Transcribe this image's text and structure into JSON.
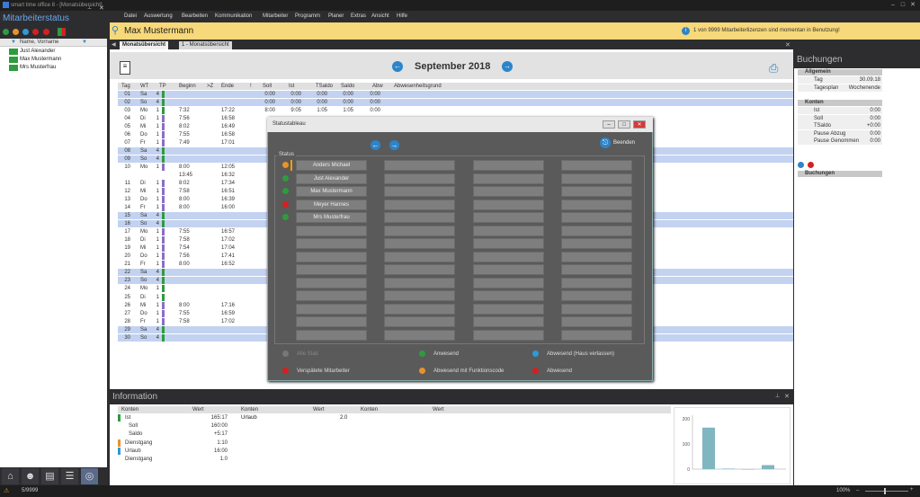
{
  "app": {
    "title": "smart time office 8 - [Monatsübersicht]"
  },
  "left": {
    "title": "Mitarbeiterstatus",
    "col": "Name, Vorname",
    "rows": [
      "Just Alexander",
      "Max Mustermann",
      "Mrs Musterfrau"
    ]
  },
  "menu": [
    "Datei",
    "Auswertung",
    "Bearbeiten",
    "Kommunikation",
    "Mitarbeiter",
    "Programm",
    "Planer",
    "Extras",
    "Ansicht",
    "Hilfe"
  ],
  "user": {
    "name": "Max Mustermann"
  },
  "license": {
    "text": "1 von 9999 Mitarbeiterlizenzen sind momentan in Benutzung!",
    "icon": "i"
  },
  "tabs": [
    "Monatsübersicht",
    "1 - Monatsübersicht"
  ],
  "month": {
    "title": "September 2018"
  },
  "columns": [
    "Tag",
    "WT",
    "TP",
    "Beginn",
    ">Z",
    "Ende",
    "!",
    "Soll",
    "Ist",
    "TSaldo",
    "Saldo",
    "Abw",
    "Abwesenheitsgrund"
  ],
  "rows": [
    {
      "tag": "01",
      "wt": "Sa",
      "tp": "4",
      "blue": true,
      "bar": "#2e9b3f",
      "b": "",
      "e": "",
      "soll": "0:00",
      "ist": "0:00",
      "ts": "0:00",
      "sal": "0:00",
      "abw": "0:00"
    },
    {
      "tag": "02",
      "wt": "So",
      "tp": "4",
      "blue": true,
      "bar": "#2e9b3f",
      "b": "",
      "e": "",
      "soll": "0:00",
      "ist": "0:00",
      "ts": "0:00",
      "sal": "0:00",
      "abw": "0:00"
    },
    {
      "tag": "03",
      "wt": "Mo",
      "tp": "1",
      "blue": false,
      "bar": "#2e9b3f",
      "b": "7:32",
      "e": "17:22",
      "soll": "8:00",
      "ist": "9:05",
      "ts": "1:05",
      "sal": "1:05",
      "abw": "0:00"
    },
    {
      "tag": "04",
      "wt": "Di",
      "tp": "1",
      "blue": false,
      "bar": "#8b6fc6",
      "b": "7:56",
      "e": "16:58",
      "soll": "",
      "ist": "",
      "ts": "",
      "sal": "",
      "abw": ""
    },
    {
      "tag": "05",
      "wt": "Mi",
      "tp": "1",
      "blue": false,
      "bar": "#8b6fc6",
      "b": "8:02",
      "e": "16:49",
      "soll": "",
      "ist": "",
      "ts": "",
      "sal": "",
      "abw": ""
    },
    {
      "tag": "06",
      "wt": "Do",
      "tp": "1",
      "blue": false,
      "bar": "#8b6fc6",
      "b": "7:55",
      "e": "16:58",
      "soll": "",
      "ist": "",
      "ts": "",
      "sal": "",
      "abw": ""
    },
    {
      "tag": "07",
      "wt": "Fr",
      "tp": "1",
      "blue": false,
      "bar": "#8b6fc6",
      "b": "7:49",
      "e": "17:01",
      "soll": "",
      "ist": "",
      "ts": "",
      "sal": "",
      "abw": ""
    },
    {
      "tag": "08",
      "wt": "Sa",
      "tp": "4",
      "blue": true,
      "bar": "#2e9b3f",
      "b": "",
      "e": "",
      "soll": "",
      "ist": "",
      "ts": "",
      "sal": "",
      "abw": ""
    },
    {
      "tag": "09",
      "wt": "So",
      "tp": "4",
      "blue": true,
      "bar": "#2e9b3f",
      "b": "",
      "e": "",
      "soll": "",
      "ist": "",
      "ts": "",
      "sal": "",
      "abw": ""
    },
    {
      "tag": "10",
      "wt": "Mo",
      "tp": "1",
      "blue": false,
      "bar": "#8b6fc6",
      "b": "8:00",
      "e": "12:05",
      "soll": "",
      "ist": "",
      "ts": "",
      "sal": "",
      "abw": ""
    },
    {
      "tag": "",
      "wt": "",
      "tp": "",
      "blue": false,
      "bar": "",
      "b": "13:45",
      "e": "16:32",
      "soll": "",
      "ist": "",
      "ts": "",
      "sal": "",
      "abw": ""
    },
    {
      "tag": "11",
      "wt": "Di",
      "tp": "1",
      "blue": false,
      "bar": "#8b6fc6",
      "b": "8:02",
      "e": "17:34",
      "soll": "",
      "ist": "",
      "ts": "",
      "sal": "",
      "abw": ""
    },
    {
      "tag": "12",
      "wt": "Mi",
      "tp": "1",
      "blue": false,
      "bar": "#8b6fc6",
      "b": "7:58",
      "e": "16:51",
      "soll": "",
      "ist": "",
      "ts": "",
      "sal": "",
      "abw": ""
    },
    {
      "tag": "13",
      "wt": "Do",
      "tp": "1",
      "blue": false,
      "bar": "#8b6fc6",
      "b": "8:00",
      "e": "16:39",
      "soll": "",
      "ist": "",
      "ts": "",
      "sal": "",
      "abw": ""
    },
    {
      "tag": "14",
      "wt": "Fr",
      "tp": "1",
      "blue": false,
      "bar": "#8b6fc6",
      "b": "8:00",
      "e": "16:00",
      "soll": "",
      "ist": "",
      "ts": "",
      "sal": "",
      "abw": ""
    },
    {
      "tag": "15",
      "wt": "Sa",
      "tp": "4",
      "blue": true,
      "bar": "#2e9b3f",
      "b": "",
      "e": "",
      "soll": "",
      "ist": "",
      "ts": "",
      "sal": "",
      "abw": ""
    },
    {
      "tag": "16",
      "wt": "So",
      "tp": "4",
      "blue": true,
      "bar": "#2e9b3f",
      "b": "",
      "e": "",
      "soll": "",
      "ist": "",
      "ts": "",
      "sal": "",
      "abw": ""
    },
    {
      "tag": "17",
      "wt": "Mo",
      "tp": "1",
      "blue": false,
      "bar": "#8b6fc6",
      "b": "7:55",
      "e": "16:57",
      "soll": "",
      "ist": "",
      "ts": "",
      "sal": "",
      "abw": ""
    },
    {
      "tag": "18",
      "wt": "Di",
      "tp": "1",
      "blue": false,
      "bar": "#8b6fc6",
      "b": "7:58",
      "e": "17:02",
      "soll": "",
      "ist": "",
      "ts": "",
      "sal": "",
      "abw": ""
    },
    {
      "tag": "19",
      "wt": "Mi",
      "tp": "1",
      "blue": false,
      "bar": "#8b6fc6",
      "b": "7:54",
      "e": "17:04",
      "soll": "",
      "ist": "",
      "ts": "",
      "sal": "",
      "abw": ""
    },
    {
      "tag": "20",
      "wt": "Do",
      "tp": "1",
      "blue": false,
      "bar": "#8b6fc6",
      "b": "7:56",
      "e": "17:41",
      "soll": "",
      "ist": "",
      "ts": "",
      "sal": "",
      "abw": ""
    },
    {
      "tag": "21",
      "wt": "Fr",
      "tp": "1",
      "blue": false,
      "bar": "#8b6fc6",
      "b": "8:00",
      "e": "16:52",
      "soll": "",
      "ist": "",
      "ts": "",
      "sal": "",
      "abw": ""
    },
    {
      "tag": "22",
      "wt": "Sa",
      "tp": "4",
      "blue": true,
      "bar": "#2e9b3f",
      "b": "",
      "e": "",
      "soll": "",
      "ist": "",
      "ts": "",
      "sal": "",
      "abw": ""
    },
    {
      "tag": "23",
      "wt": "So",
      "tp": "4",
      "blue": true,
      "bar": "#2e9b3f",
      "b": "",
      "e": "",
      "soll": "",
      "ist": "",
      "ts": "",
      "sal": "",
      "abw": ""
    },
    {
      "tag": "24",
      "wt": "Mo",
      "tp": "1",
      "blue": false,
      "bar": "#2e9b3f",
      "b": "",
      "e": "",
      "soll": "",
      "ist": "",
      "ts": "",
      "sal": "",
      "abw": ""
    },
    {
      "tag": "25",
      "wt": "Di",
      "tp": "1",
      "blue": false,
      "bar": "#2e9b3f",
      "b": "",
      "e": "",
      "soll": "",
      "ist": "",
      "ts": "",
      "sal": "",
      "abw": ""
    },
    {
      "tag": "26",
      "wt": "Mi",
      "tp": "1",
      "blue": false,
      "bar": "#8b6fc6",
      "b": "8:00",
      "e": "17:16",
      "soll": "",
      "ist": "",
      "ts": "",
      "sal": "",
      "abw": ""
    },
    {
      "tag": "27",
      "wt": "Do",
      "tp": "1",
      "blue": false,
      "bar": "#8b6fc6",
      "b": "7:55",
      "e": "16:59",
      "soll": "",
      "ist": "",
      "ts": "",
      "sal": "",
      "abw": ""
    },
    {
      "tag": "28",
      "wt": "Fr",
      "tp": "1",
      "blue": false,
      "bar": "#8b6fc6",
      "b": "7:58",
      "e": "17:02",
      "soll": "",
      "ist": "",
      "ts": "",
      "sal": "",
      "abw": ""
    },
    {
      "tag": "29",
      "wt": "Sa",
      "tp": "4",
      "blue": true,
      "bar": "#2e9b3f",
      "b": "",
      "e": "",
      "soll": "",
      "ist": "",
      "ts": "",
      "sal": "",
      "abw": ""
    },
    {
      "tag": "30",
      "wt": "So",
      "tp": "4",
      "blue": true,
      "bar": "#2e9b3f",
      "b": "",
      "e": "",
      "soll": "",
      "ist": "",
      "ts": "",
      "sal": "",
      "abw": ""
    }
  ],
  "right": {
    "title": "Buchungen",
    "sections": [
      {
        "label": "Allgemein",
        "items": [
          {
            "k": "Tag",
            "v": "30.09.18"
          },
          {
            "k": "Tagesplan",
            "v": "Wochenende"
          }
        ]
      },
      {
        "label": "Konten",
        "items": [
          {
            "k": "Ist",
            "v": "0:00"
          },
          {
            "k": "Soll",
            "v": "0:00"
          },
          {
            "k": "TSaldo",
            "v": "+0:00"
          },
          {
            "k": "Pause Abzug",
            "v": "0:00"
          },
          {
            "k": "Pause Genommen",
            "v": "0:00"
          }
        ]
      }
    ],
    "bookings": "Buchungen"
  },
  "info": {
    "title": "Information",
    "cols": [
      "Konten",
      "Wert",
      "Konten",
      "Wert",
      "Konten",
      "Wert"
    ],
    "rows": [
      {
        "k": "Ist",
        "v": "165:17",
        "c": "#2e9b3f"
      },
      {
        "k": "Soll",
        "v": "160:00",
        "c": ""
      },
      {
        "k": "Saldo",
        "v": "+5:17",
        "c": ""
      },
      {
        "k": "Dienstgang",
        "v": "1:10",
        "c": "#e8922e"
      },
      {
        "k": "Urlaub",
        "v": "16:00",
        "c": "#2d9ad8"
      },
      {
        "k": "Dienstgang",
        "v": "1.0",
        "c": ""
      }
    ],
    "mid": {
      "k": "Urlaub",
      "v": "2.0"
    }
  },
  "chart_data": {
    "type": "bar",
    "ylim": [
      0,
      200
    ],
    "ticks": [
      "200",
      "100",
      "0"
    ],
    "values": [
      165,
      2,
      0,
      16
    ],
    "color": "#7fb6c0"
  },
  "status": {
    "count": "5/9999",
    "zoom": "100%"
  },
  "dialog": {
    "title": "Statustableau",
    "close": "Beenden",
    "group": "Status",
    "employees": [
      {
        "name": "Anders Michael",
        "color": "#e8922e",
        "mark": true
      },
      {
        "name": "Just Alexander",
        "color": "#2e9b3f",
        "mark": false
      },
      {
        "name": "Max Mustermann",
        "color": "#2e9b3f",
        "mark": false
      },
      {
        "name": "Meyer Hannes",
        "color": "#d42020",
        "mark": false
      },
      {
        "name": "Mrs Musterfrau",
        "color": "#2e9b3f",
        "mark": false
      }
    ],
    "legend": [
      {
        "t": "Alle Stati",
        "c": "#777"
      },
      {
        "t": "Verspätete Mitarbeiter",
        "c": "#d42020"
      },
      {
        "t": "Anwesend",
        "c": "#2e9b3f"
      },
      {
        "t": "Abwesend mit Funktionscode",
        "c": "#e8922e"
      },
      {
        "t": "Abwesend (Haus verlassen)",
        "c": "#2d9ad8"
      },
      {
        "t": "Abwesend",
        "c": "#d42020"
      }
    ]
  }
}
